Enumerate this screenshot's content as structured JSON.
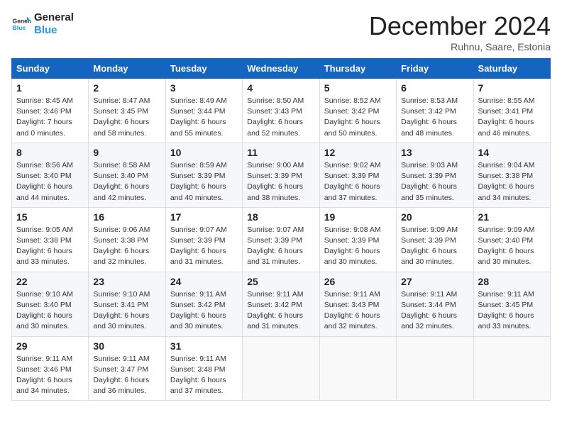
{
  "header": {
    "logo_line1": "General",
    "logo_line2": "Blue",
    "month_title": "December 2024",
    "location": "Ruhnu, Saare, Estonia"
  },
  "days_of_week": [
    "Sunday",
    "Monday",
    "Tuesday",
    "Wednesday",
    "Thursday",
    "Friday",
    "Saturday"
  ],
  "weeks": [
    [
      {
        "day": "1",
        "sunrise": "8:45 AM",
        "sunset": "3:46 PM",
        "daylight": "7 hours and 0 minutes."
      },
      {
        "day": "2",
        "sunrise": "8:47 AM",
        "sunset": "3:45 PM",
        "daylight": "6 hours and 58 minutes."
      },
      {
        "day": "3",
        "sunrise": "8:49 AM",
        "sunset": "3:44 PM",
        "daylight": "6 hours and 55 minutes."
      },
      {
        "day": "4",
        "sunrise": "8:50 AM",
        "sunset": "3:43 PM",
        "daylight": "6 hours and 52 minutes."
      },
      {
        "day": "5",
        "sunrise": "8:52 AM",
        "sunset": "3:42 PM",
        "daylight": "6 hours and 50 minutes."
      },
      {
        "day": "6",
        "sunrise": "8:53 AM",
        "sunset": "3:42 PM",
        "daylight": "6 hours and 48 minutes."
      },
      {
        "day": "7",
        "sunrise": "8:55 AM",
        "sunset": "3:41 PM",
        "daylight": "6 hours and 46 minutes."
      }
    ],
    [
      {
        "day": "8",
        "sunrise": "8:56 AM",
        "sunset": "3:40 PM",
        "daylight": "6 hours and 44 minutes."
      },
      {
        "day": "9",
        "sunrise": "8:58 AM",
        "sunset": "3:40 PM",
        "daylight": "6 hours and 42 minutes."
      },
      {
        "day": "10",
        "sunrise": "8:59 AM",
        "sunset": "3:39 PM",
        "daylight": "6 hours and 40 minutes."
      },
      {
        "day": "11",
        "sunrise": "9:00 AM",
        "sunset": "3:39 PM",
        "daylight": "6 hours and 38 minutes."
      },
      {
        "day": "12",
        "sunrise": "9:02 AM",
        "sunset": "3:39 PM",
        "daylight": "6 hours and 37 minutes."
      },
      {
        "day": "13",
        "sunrise": "9:03 AM",
        "sunset": "3:39 PM",
        "daylight": "6 hours and 35 minutes."
      },
      {
        "day": "14",
        "sunrise": "9:04 AM",
        "sunset": "3:38 PM",
        "daylight": "6 hours and 34 minutes."
      }
    ],
    [
      {
        "day": "15",
        "sunrise": "9:05 AM",
        "sunset": "3:38 PM",
        "daylight": "6 hours and 33 minutes."
      },
      {
        "day": "16",
        "sunrise": "9:06 AM",
        "sunset": "3:38 PM",
        "daylight": "6 hours and 32 minutes."
      },
      {
        "day": "17",
        "sunrise": "9:07 AM",
        "sunset": "3:39 PM",
        "daylight": "6 hours and 31 minutes."
      },
      {
        "day": "18",
        "sunrise": "9:07 AM",
        "sunset": "3:39 PM",
        "daylight": "6 hours and 31 minutes."
      },
      {
        "day": "19",
        "sunrise": "9:08 AM",
        "sunset": "3:39 PM",
        "daylight": "6 hours and 30 minutes."
      },
      {
        "day": "20",
        "sunrise": "9:09 AM",
        "sunset": "3:39 PM",
        "daylight": "6 hours and 30 minutes."
      },
      {
        "day": "21",
        "sunrise": "9:09 AM",
        "sunset": "3:40 PM",
        "daylight": "6 hours and 30 minutes."
      }
    ],
    [
      {
        "day": "22",
        "sunrise": "9:10 AM",
        "sunset": "3:40 PM",
        "daylight": "6 hours and 30 minutes."
      },
      {
        "day": "23",
        "sunrise": "9:10 AM",
        "sunset": "3:41 PM",
        "daylight": "6 hours and 30 minutes."
      },
      {
        "day": "24",
        "sunrise": "9:11 AM",
        "sunset": "3:42 PM",
        "daylight": "6 hours and 30 minutes."
      },
      {
        "day": "25",
        "sunrise": "9:11 AM",
        "sunset": "3:42 PM",
        "daylight": "6 hours and 31 minutes."
      },
      {
        "day": "26",
        "sunrise": "9:11 AM",
        "sunset": "3:43 PM",
        "daylight": "6 hours and 32 minutes."
      },
      {
        "day": "27",
        "sunrise": "9:11 AM",
        "sunset": "3:44 PM",
        "daylight": "6 hours and 32 minutes."
      },
      {
        "day": "28",
        "sunrise": "9:11 AM",
        "sunset": "3:45 PM",
        "daylight": "6 hours and 33 minutes."
      }
    ],
    [
      {
        "day": "29",
        "sunrise": "9:11 AM",
        "sunset": "3:46 PM",
        "daylight": "6 hours and 34 minutes."
      },
      {
        "day": "30",
        "sunrise": "9:11 AM",
        "sunset": "3:47 PM",
        "daylight": "6 hours and 36 minutes."
      },
      {
        "day": "31",
        "sunrise": "9:11 AM",
        "sunset": "3:48 PM",
        "daylight": "6 hours and 37 minutes."
      },
      null,
      null,
      null,
      null
    ]
  ],
  "labels": {
    "sunrise": "Sunrise:",
    "sunset": "Sunset:",
    "daylight": "Daylight:"
  }
}
